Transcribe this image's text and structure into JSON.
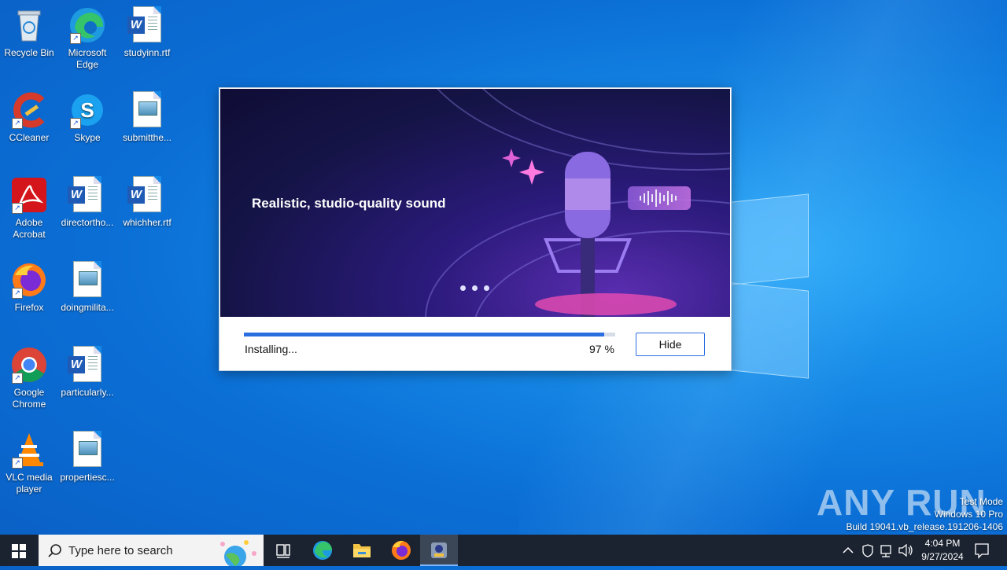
{
  "desktop": {
    "icons": [
      {
        "label": "Recycle Bin",
        "icon": "recycle-bin-icon"
      },
      {
        "label": "Microsoft Edge",
        "icon": "edge-icon"
      },
      {
        "label": "studyinn.rtf",
        "icon": "word-doc-icon"
      },
      {
        "label": "CCleaner",
        "icon": "ccleaner-icon"
      },
      {
        "label": "Skype",
        "icon": "skype-icon"
      },
      {
        "label": "submitthe...",
        "icon": "image-file-icon"
      },
      {
        "label": "Adobe Acrobat",
        "icon": "acrobat-icon"
      },
      {
        "label": "directortho...",
        "icon": "word-doc-icon"
      },
      {
        "label": "whichher.rtf",
        "icon": "word-doc-icon"
      },
      {
        "label": "Firefox",
        "icon": "firefox-icon"
      },
      {
        "label": "doingmilita...",
        "icon": "image-file-icon"
      },
      {
        "label": "Google Chrome",
        "icon": "chrome-icon"
      },
      {
        "label": "particularly...",
        "icon": "word-doc-icon"
      },
      {
        "label": "VLC media player",
        "icon": "vlc-icon"
      },
      {
        "label": "propertiesc...",
        "icon": "image-file-icon"
      }
    ]
  },
  "installer": {
    "headline": "Realistic, studio-quality sound",
    "status": "Installing...",
    "percent_label": "97 %",
    "progress": 0.97,
    "hide_label": "Hide",
    "accent": "#2a6fe0"
  },
  "watermark": {
    "brand": "ANY RUN",
    "line1": "Test Mode",
    "line2": "Windows 10 Pro",
    "line3": "Build 19041.vb_release.191206-1406"
  },
  "taskbar": {
    "search_placeholder": "Type here to search",
    "time": "4:04 PM",
    "date": "9/27/2024",
    "color": "#1b2331"
  }
}
